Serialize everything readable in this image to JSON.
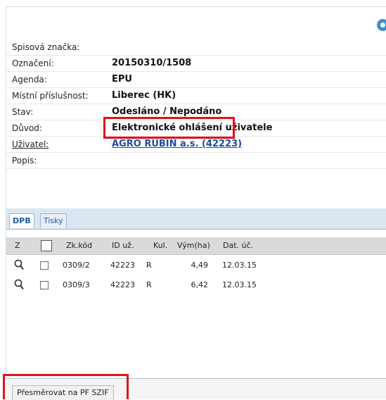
{
  "detail": {
    "rows": [
      {
        "label": "Spisová značka:",
        "value": ""
      },
      {
        "label": "Označení:",
        "value": "20150310/1508"
      },
      {
        "label": "Agenda:",
        "value": "EPU"
      },
      {
        "label": "Místní příslušnost:",
        "value": "Liberec (HK)"
      },
      {
        "label": "Stav:",
        "value": "Odesláno / Nepodáno"
      },
      {
        "label": "Důvod:",
        "value": "Elektronické ohlášení uživatele"
      },
      {
        "label": "Uživatel:",
        "value": "AGRO RUBÍN a.s. (42223)"
      },
      {
        "label": "Popis:",
        "value": ""
      }
    ]
  },
  "tabs": [
    {
      "label": "DPB",
      "active": true
    },
    {
      "label": "Tisky",
      "active": false
    }
  ],
  "grid": {
    "columns": [
      "Z",
      "",
      "Zk.kód",
      "ID už.",
      "Kul.",
      "Vým(ha)",
      "Dat. úč."
    ],
    "rows": [
      {
        "zk_kod": "0309/2",
        "id_uz": "42223",
        "kul": "R",
        "vym": "4,49",
        "dat_uc": "12.03.15"
      },
      {
        "zk_kod": "0309/3",
        "id_uz": "42223",
        "kul": "R",
        "vym": "6,42",
        "dat_uc": "12.03.15"
      }
    ]
  },
  "actions": {
    "redirect_label": "Přesměrovat na PF SZIF"
  },
  "colors": {
    "highlight": "#e0121a",
    "link": "#1a4fa0",
    "tab_text": "#1b5aa8",
    "grid_header": "#dadada"
  }
}
